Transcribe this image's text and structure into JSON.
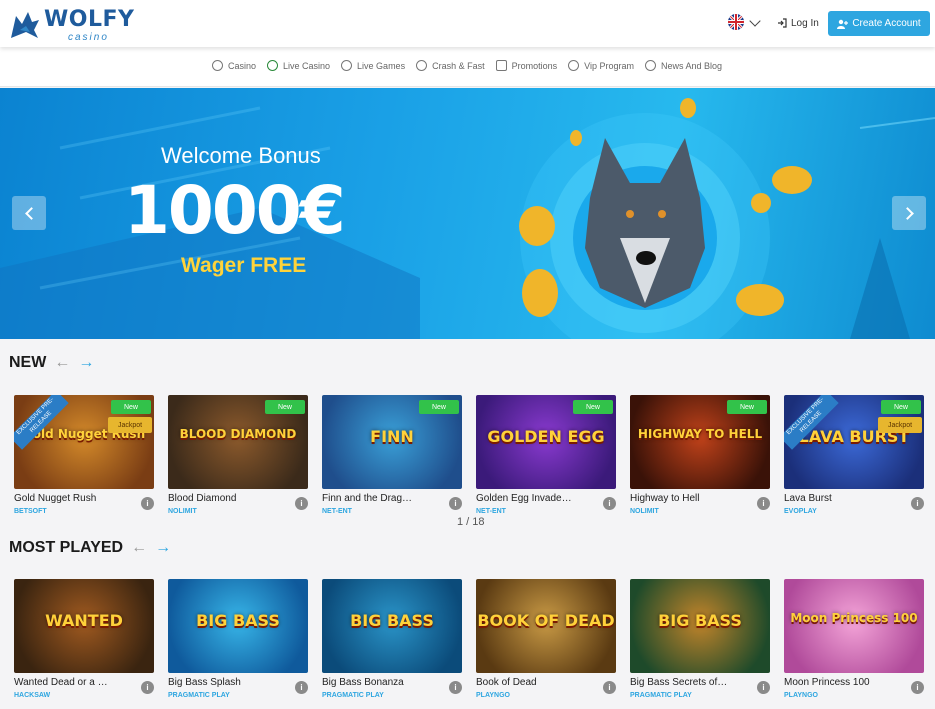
{
  "header": {
    "logo_word": "WOLFY",
    "logo_sub": "casino",
    "lang_icon": "uk-flag-icon",
    "login_label": "Log In",
    "create_label": "Create Account"
  },
  "nav": {
    "items": [
      {
        "label": "Casino",
        "icon": "casino-icon"
      },
      {
        "label": "Live Casino",
        "icon": "live-casino-icon"
      },
      {
        "label": "Live Games",
        "icon": "live-games-icon"
      },
      {
        "label": "Crash & Fast",
        "icon": "crash-icon"
      },
      {
        "label": "Promotions",
        "icon": "gift-icon"
      },
      {
        "label": "Vip Program",
        "icon": "crown-icon"
      },
      {
        "label": "News And Blog",
        "icon": "news-icon"
      }
    ]
  },
  "hero": {
    "line1": "Welcome Bonus",
    "line2": "1000€",
    "line3": "Wager FREE"
  },
  "sections": {
    "new": {
      "title": "NEW",
      "pager": "1 / 18",
      "games": [
        {
          "name": "Gold Nugget Rush",
          "provider": "BETSOFT",
          "art": "Gold Nugget Rush",
          "badge": "New",
          "jackpot": "Jackpot",
          "ribbon": "EXCLUSIVE PRE-RELEASE",
          "color1": "#7a3d14",
          "color2": "#d48a2a"
        },
        {
          "name": "Blood Diamond",
          "provider": "NOLIMIT",
          "art": "BLOOD DIAMOND",
          "badge": "New",
          "color1": "#3b2a1a",
          "color2": "#8c5a2c"
        },
        {
          "name": "Finn and the Drag…",
          "provider": "NET-ENT",
          "art": "FINN",
          "badge": "New",
          "color1": "#1f4e8c",
          "color2": "#3aa0d8"
        },
        {
          "name": "Golden Egg Invade…",
          "provider": "NET-ENT",
          "art": "GOLDEN EGG",
          "badge": "New",
          "color1": "#3b1a7a",
          "color2": "#8a3ad0"
        },
        {
          "name": "Highway to Hell",
          "provider": "NOLIMIT",
          "art": "HIGHWAY TO HELL",
          "badge": "New",
          "color1": "#3a1208",
          "color2": "#c0421a"
        },
        {
          "name": "Lava Burst",
          "provider": "EVOPLAY",
          "art": "LAVA BURST",
          "badge": "New",
          "jackpot": "Jackpot",
          "ribbon": "EXCLUSIVE PRE-RELEASE",
          "color1": "#1b2f7a",
          "color2": "#3c6ad8"
        }
      ]
    },
    "most_played": {
      "title": "MOST PLAYED",
      "games": [
        {
          "name": "Wanted Dead or a …",
          "provider": "HACKSAW",
          "art": "WANTED",
          "color1": "#3a2410",
          "color2": "#a05a20"
        },
        {
          "name": "Big Bass Splash",
          "provider": "PRAGMATIC PLAY",
          "art": "BIG BASS",
          "color1": "#0f5a9c",
          "color2": "#37b5e8"
        },
        {
          "name": "Big Bass Bonanza",
          "provider": "PRAGMATIC PLAY",
          "art": "BIG BASS",
          "color1": "#0b4b7a",
          "color2": "#2a94c8"
        },
        {
          "name": "Book of Dead",
          "provider": "PLAYNGO",
          "art": "BOOK OF DEAD",
          "color1": "#5a3a12",
          "color2": "#c99a45"
        },
        {
          "name": "Big Bass Secrets of…",
          "provider": "PRAGMATIC PLAY",
          "art": "BIG BASS",
          "color1": "#1e4a2a",
          "color2": "#c2842a"
        },
        {
          "name": "Moon Princess 100",
          "provider": "PLAYNGO",
          "art": "Moon Princess 100",
          "color1": "#b04a9a",
          "color2": "#f4a4d8"
        }
      ]
    }
  },
  "colors": {
    "accent": "#2ea6e0",
    "badge_new": "#32c24a",
    "badge_jackpot": "#e7b62e",
    "hero_yellow": "#ffd33a"
  }
}
